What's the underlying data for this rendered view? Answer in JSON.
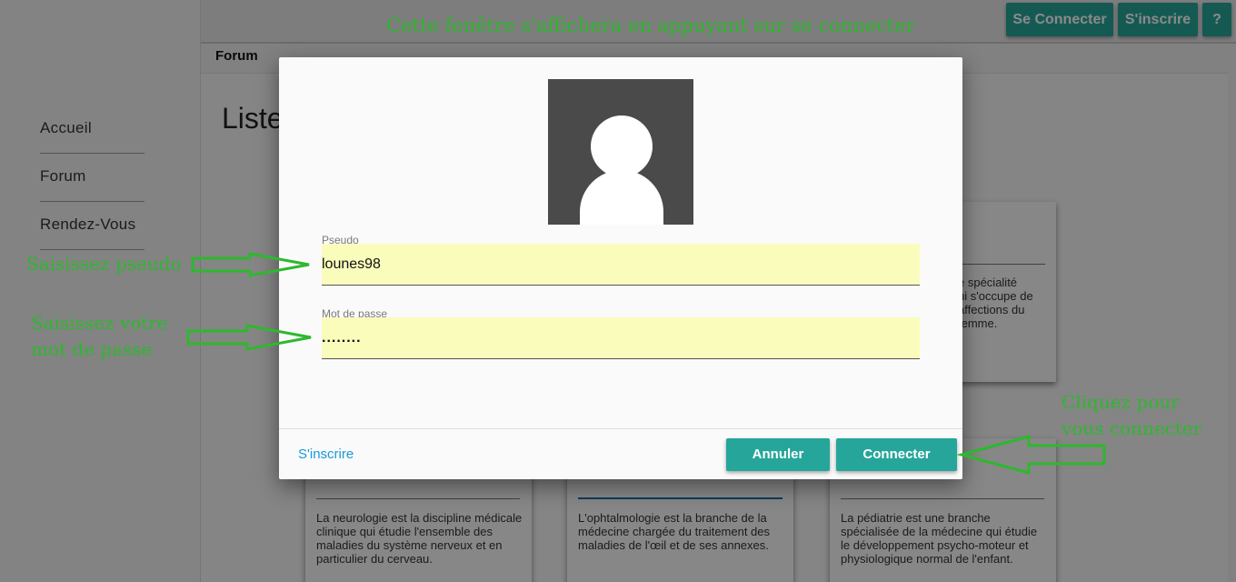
{
  "sidebar": {
    "items": [
      {
        "label": "Accueil"
      },
      {
        "label": "Forum"
      },
      {
        "label": "Rendez-Vous"
      }
    ]
  },
  "header": {
    "annotation": "Cette fenêtre s'affichera en appuyant sur se connecter",
    "login_label": "Se Connecter",
    "signup_label": "S'inscrire",
    "help_label": "?"
  },
  "breadcrumb": "Forum",
  "page": {
    "title": "Liste"
  },
  "cards": [
    {
      "title": "",
      "text": "La neurologie est la discipline médicale clinique qui étudie l'ensemble des maladies du système nerveux et en particulier du cerveau."
    },
    {
      "title": "",
      "text": "L'ophtalmologie est la branche de la médecine chargée du traitement des maladies de l'œil et de ses annexes."
    },
    {
      "title": "",
      "text": "La pédiatrie est une branche spécialisée de la médecine qui étudie le développement psycho-moteur et physiologique normal de l'enfant."
    },
    {
      "title": "e",
      "text": "e spécialité\nui s'occupe de\naffections du\nfemme."
    }
  ],
  "login_modal": {
    "pseudo_label": "Pseudo",
    "pseudo_value": "lounes98",
    "password_label": "Mot de passe",
    "password_value": "........",
    "signup_link": "S'inscrire",
    "cancel_label": "Annuler",
    "connect_label": "Connecter"
  },
  "annotations": {
    "pseudo": "Saisissez pseudo",
    "password_line1": "Saisissez votre",
    "password_line2": "mot de passe",
    "connect_line1": "Cliquez pour",
    "connect_line2": "vous connecter"
  },
  "colors": {
    "accent": "#26a69a",
    "link": "#1a9ad6",
    "annotation": "#2db82d",
    "input_bg": "#fafcbb"
  }
}
